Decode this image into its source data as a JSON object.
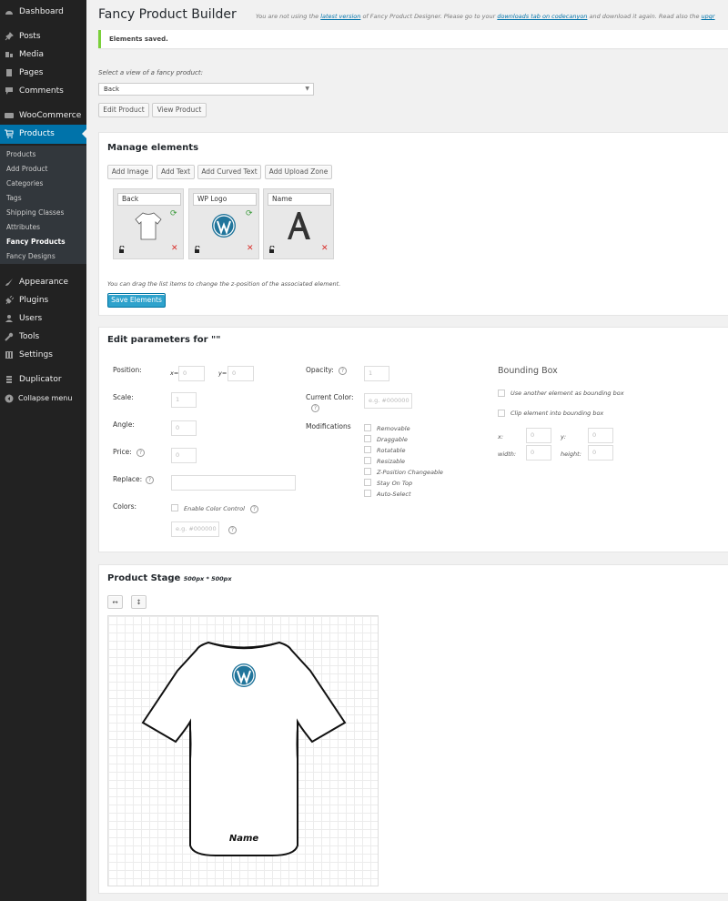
{
  "sidebar": {
    "items": [
      {
        "label": "Dashboard",
        "icon": "dashboard-icon"
      },
      {
        "label": "Posts",
        "icon": "pin-icon"
      },
      {
        "label": "Media",
        "icon": "media-icon"
      },
      {
        "label": "Pages",
        "icon": "pages-icon"
      },
      {
        "label": "Comments",
        "icon": "comment-icon"
      },
      {
        "label": "WooCommerce",
        "icon": "woocommerce-icon"
      },
      {
        "label": "Products",
        "icon": "cart-icon"
      },
      {
        "label": "Appearance",
        "icon": "brush-icon"
      },
      {
        "label": "Plugins",
        "icon": "plug-icon"
      },
      {
        "label": "Users",
        "icon": "user-icon"
      },
      {
        "label": "Tools",
        "icon": "wrench-icon"
      },
      {
        "label": "Settings",
        "icon": "settings-icon"
      },
      {
        "label": "Duplicator",
        "icon": "duplicator-icon"
      },
      {
        "label": "Collapse menu",
        "icon": "collapse-icon"
      }
    ],
    "submenu": [
      "Products",
      "Add Product",
      "Categories",
      "Tags",
      "Shipping Classes",
      "Attributes",
      "Fancy Products",
      "Fancy Designs"
    ]
  },
  "header": {
    "title": "Fancy Product Builder",
    "notice_prefix": "You are not using the ",
    "notice_link1": "latest version",
    "notice_mid": " of Fancy Product Designer. Please go to your ",
    "notice_link2": "downloads tab on codecanyon",
    "notice_mid2": " and download it again. Read also the ",
    "notice_link3": "upgr"
  },
  "saved_notice": "Elements saved.",
  "view": {
    "label": "Select a view of a fancy product:",
    "selected": "Back",
    "edit_product": "Edit Product",
    "view_product": "View Product"
  },
  "manage": {
    "title": "Manage elements",
    "buttons": [
      "Add Image",
      "Add Text",
      "Add Curved Text",
      "Add Upload Zone"
    ],
    "elements": [
      "Back",
      "WP Logo",
      "Name"
    ],
    "hint": "You can drag the list items to change the z-position of the associated element.",
    "save": "Save Elements"
  },
  "params": {
    "title": "Edit parameters for \"\"",
    "position": "Position:",
    "x_label": "x=",
    "y_label": "y=",
    "x_value": "0",
    "y_value": "0",
    "scale": "Scale:",
    "scale_value": "1",
    "angle": "Angle:",
    "angle_value": "0",
    "price": "Price:",
    "price_value": "0",
    "replace": "Replace:",
    "colors": "Colors:",
    "enable_color": "Enable Color Control",
    "color_placeholder": "e.g. #000000",
    "opacity": "Opacity:",
    "opacity_value": "1",
    "current_color": "Current Color:",
    "current_color_placeholder": "e.g. #000000",
    "modifications": "Modifications",
    "mods": [
      "Removable",
      "Draggable",
      "Rotatable",
      "Resizable",
      "Z-Position Changeable",
      "Stay On Top",
      "Auto-Select"
    ],
    "bbox_title": "Bounding Box",
    "bbox_use_other": "Use another element as bounding box",
    "bbox_clip": "Clip element into bounding box",
    "bbox_x": "x:",
    "bbox_y": "y:",
    "bbox_width": "width:",
    "bbox_height": "height:",
    "bbox_x_value": "0",
    "bbox_y_value": "0",
    "bbox_w_value": "0",
    "bbox_h_value": "0",
    "help_glyph": "?"
  },
  "stage": {
    "title": "Product Stage",
    "size": "500px * 500px",
    "text_element": "Name",
    "tool_horizontal": "↔",
    "tool_vertical": "↕"
  },
  "colors": {
    "sidebar_bg": "#222222",
    "active_blue": "#0073aa",
    "wp_blue": "#21759b",
    "saved_green": "#7ad03a"
  }
}
